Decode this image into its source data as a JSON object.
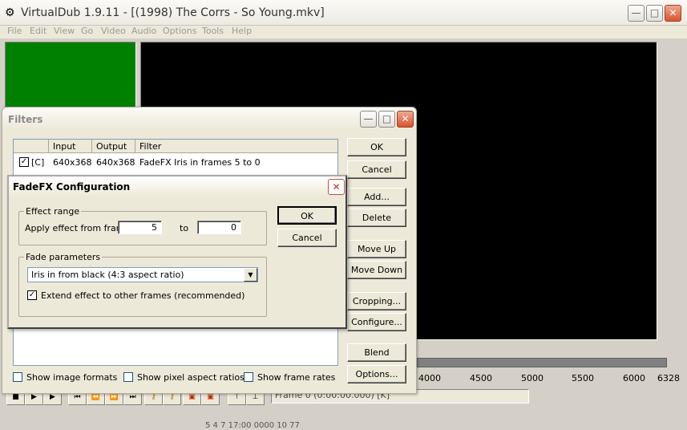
{
  "app": {
    "title": "VirtualDub 1.9.11 - [(1998) The Corrs - So Young.mkv]",
    "menus": [
      "File",
      "Edit",
      "View",
      "Go",
      "Video",
      "Audio",
      "Options",
      "Tools",
      "Help"
    ],
    "status_frame": "Frame 0 (0:00:00.000) [K]",
    "timeline_ticks": [
      "4000",
      "4500",
      "5000",
      "5500",
      "6000",
      "6328"
    ],
    "bottom_partial": "5 4 7   17:00  0000  10  77"
  },
  "filters": {
    "title": "Filters",
    "columns": [
      "Input",
      "Output",
      "Filter"
    ],
    "rows": [
      {
        "flag": "[C]",
        "input": "640x368",
        "output": "640x368",
        "filter": "FadeFX Iris in frames 5 to 0",
        "checked": true
      }
    ],
    "buttons": {
      "ok": "OK",
      "cancel": "Cancel",
      "add": "Add...",
      "delete": "Delete",
      "move_up": "Move Up",
      "move_down": "Move Down",
      "cropping": "Cropping...",
      "configure": "Configure...",
      "blend": "Blend",
      "options": "Options..."
    },
    "checkboxes": {
      "image_formats": "Show image formats",
      "pixel_aspect": "Show pixel aspect ratios",
      "frame_rates": "Show frame rates"
    }
  },
  "fadefx": {
    "title": "FadeFX Configuration",
    "effect_range_label": "Effect range",
    "apply_label": "Apply effect from frame",
    "from_value": "5",
    "to_label": "to",
    "to_value": "0",
    "fade_params_label": "Fade parameters",
    "fade_select": "Iris in from black (4:3 aspect ratio)",
    "extend_label": "Extend effect to other frames (recommended)",
    "extend_checked": true,
    "ok": "OK",
    "cancel": "Cancel"
  },
  "colors": {
    "input_pane": "#008000",
    "output_pane": "#000000",
    "dialog_bg": "#ece9d8"
  }
}
